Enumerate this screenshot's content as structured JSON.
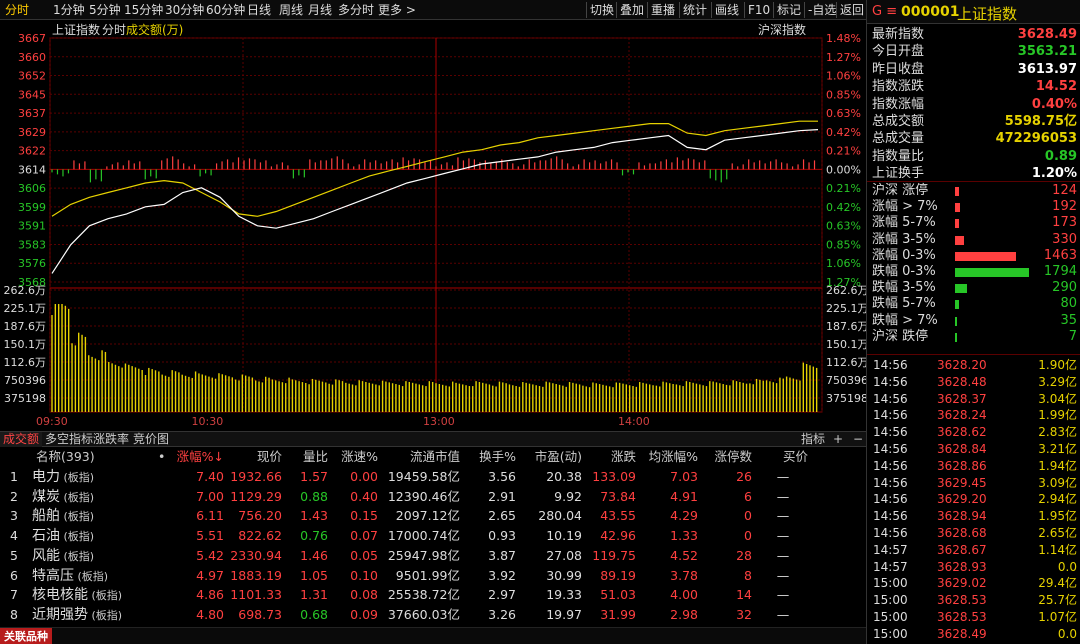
{
  "toolbar": {
    "periods": [
      "分时",
      "1分钟",
      "5分钟",
      "15分钟",
      "30分钟",
      "60分钟",
      "日线",
      "周线",
      "月线",
      "多分时",
      "更多 >"
    ],
    "tools": [
      "切换",
      "叠加",
      "重播",
      "统计",
      "画线",
      "F10",
      "标记",
      "-自选",
      "返回"
    ]
  },
  "chart": {
    "legend_name": "上证指数",
    "legend_mode": "分时",
    "legend_ind": "成交额(万)",
    "right_label": "沪深指数",
    "price_ticks": [
      "3667",
      "3660",
      "3652",
      "3645",
      "3637",
      "3629",
      "3622",
      "3614",
      "3606",
      "3599",
      "3591",
      "3583",
      "3576",
      "3568"
    ],
    "pct_ticks": [
      "1.48%",
      "1.27%",
      "1.06%",
      "0.85%",
      "0.63%",
      "0.42%",
      "0.21%",
      "0.00%",
      "0.21%",
      "0.42%",
      "0.63%",
      "0.85%",
      "1.06%",
      "1.27%"
    ],
    "vol_ticks": [
      "262.6万",
      "225.1万",
      "187.6万",
      "150.1万",
      "112.6万",
      "750396",
      "375198"
    ],
    "time_labels": [
      "09:30",
      "10:30",
      "13:00",
      "14:00"
    ]
  },
  "chart_data": {
    "type": "line",
    "title": "上证指数 分时",
    "prev_close": 3613.97,
    "x_labels": [
      "09:30",
      "10:30",
      "13:00",
      "14:00",
      "15:00"
    ],
    "series": [
      {
        "name": "指数",
        "color": "#ffffff",
        "values": [
          3568,
          3580,
          3588,
          3591,
          3593,
          3596,
          3597,
          3602,
          3604,
          3600,
          3592,
          3588,
          3587,
          3589,
          3591,
          3594,
          3597,
          3600,
          3603,
          3606,
          3608,
          3610,
          3612,
          3614,
          3615,
          3616,
          3617,
          3619,
          3620,
          3621,
          3623,
          3624,
          3625,
          3626,
          3621,
          3620,
          3624,
          3625,
          3626,
          3627,
          3628,
          3628.49
        ]
      },
      {
        "name": "均线",
        "color": "#e6d200",
        "values": [
          3592,
          3597,
          3600,
          3602,
          3604,
          3606,
          3607,
          3606,
          3602,
          3598,
          3593,
          3592,
          3594,
          3597,
          3600,
          3603,
          3606,
          3609,
          3611,
          3613,
          3615,
          3617,
          3619,
          3620,
          3622,
          3623,
          3625,
          3626,
          3627,
          3628,
          3629,
          3630,
          3631,
          3631,
          3627,
          3626,
          3628,
          3629,
          3630,
          3631,
          3632,
          3632
        ]
      }
    ],
    "volume": [
      262,
      180,
      140,
      120,
      110,
      100,
      95,
      92,
      90,
      88,
      85,
      80,
      78,
      76,
      75,
      74,
      72,
      72,
      71,
      70,
      70,
      69,
      68,
      70,
      69,
      68,
      68,
      69,
      68,
      67,
      67,
      68,
      68,
      69,
      70,
      70,
      71,
      72,
      75,
      78,
      85,
      112
    ],
    "ad_bars": [
      -1,
      2,
      -3,
      1,
      2,
      -2,
      3,
      1,
      -1,
      2,
      3,
      2,
      1,
      -2,
      2,
      3,
      1,
      2,
      2,
      3,
      2,
      1,
      3,
      2,
      2,
      1,
      2,
      3,
      1,
      2,
      2,
      -1,
      1,
      2,
      3,
      2,
      -3,
      1,
      2,
      2,
      1,
      2
    ]
  },
  "bottom_tabs": [
    "成交额",
    "多空指标",
    "涨跌率",
    "竞价图"
  ],
  "bottom_right": [
    "指标",
    "+",
    "−"
  ],
  "table": {
    "headers": [
      "名称(393)",
      "•",
      "涨幅%↓",
      "现价",
      "量比",
      "涨速%",
      "流通市值",
      "换手%",
      "市盈(动)",
      "涨跌",
      "均涨幅%",
      "涨停数",
      "买价"
    ],
    "rows": [
      {
        "idx": "1",
        "name": "电力",
        "tag": "(板指)",
        "pct": "7.40",
        "price": "1932.66",
        "lb": "1.57",
        "spd": "0.00",
        "cap": "19459.58亿",
        "turn": "3.56",
        "pe": "20.38",
        "chg": "133.09",
        "avg": "7.03",
        "zt": "26",
        "bid": "—"
      },
      {
        "idx": "2",
        "name": "煤炭",
        "tag": "(板指)",
        "pct": "7.00",
        "price": "1129.29",
        "lb": "0.88",
        "spd": "0.40",
        "cap": "12390.46亿",
        "turn": "2.91",
        "pe": "9.92",
        "chg": "73.84",
        "avg": "4.91",
        "zt": "6",
        "bid": "—"
      },
      {
        "idx": "3",
        "name": "船舶",
        "tag": "(板指)",
        "pct": "6.11",
        "price": "756.20",
        "lb": "1.43",
        "spd": "0.15",
        "cap": "2097.12亿",
        "turn": "2.65",
        "pe": "280.04",
        "chg": "43.55",
        "avg": "4.29",
        "zt": "0",
        "bid": "—"
      },
      {
        "idx": "4",
        "name": "石油",
        "tag": "(板指)",
        "pct": "5.51",
        "price": "822.62",
        "lb": "0.76",
        "spd": "0.07",
        "cap": "17000.74亿",
        "turn": "0.93",
        "pe": "10.19",
        "chg": "42.96",
        "avg": "1.33",
        "zt": "0",
        "bid": "—"
      },
      {
        "idx": "5",
        "name": "风能",
        "tag": "(板指)",
        "pct": "5.42",
        "price": "2330.94",
        "lb": "1.46",
        "spd": "0.05",
        "cap": "25947.98亿",
        "turn": "3.87",
        "pe": "27.08",
        "chg": "119.75",
        "avg": "4.52",
        "zt": "28",
        "bid": "—"
      },
      {
        "idx": "6",
        "name": "特高压",
        "tag": "(板指)",
        "pct": "4.97",
        "price": "1883.19",
        "lb": "1.05",
        "spd": "0.10",
        "cap": "9501.99亿",
        "turn": "3.92",
        "pe": "30.99",
        "chg": "89.19",
        "avg": "3.78",
        "zt": "8",
        "bid": "—"
      },
      {
        "idx": "7",
        "name": "核电核能",
        "tag": "(板指)",
        "pct": "4.86",
        "price": "1101.33",
        "lb": "1.31",
        "spd": "0.08",
        "cap": "25538.72亿",
        "turn": "2.97",
        "pe": "19.33",
        "chg": "51.03",
        "avg": "4.00",
        "zt": "14",
        "bid": "—"
      },
      {
        "idx": "8",
        "name": "近期强势",
        "tag": "(板指)",
        "pct": "4.80",
        "price": "698.73",
        "lb": "0.68",
        "spd": "0.09",
        "cap": "37660.03亿",
        "turn": "3.26",
        "pe": "19.97",
        "chg": "31.99",
        "avg": "2.98",
        "zt": "32",
        "bid": "—"
      }
    ]
  },
  "related_label": "关联品种",
  "panel": {
    "code_prefix": "G ≡",
    "code": "000001",
    "name": "上证指数",
    "stats": [
      {
        "label": "最新指数",
        "value": "3628.49",
        "color": "#ff4040"
      },
      {
        "label": "今日开盘",
        "value": "3563.21",
        "color": "#27c627"
      },
      {
        "label": "昨日收盘",
        "value": "3613.97",
        "color": "#ffffff"
      },
      {
        "label": "指数涨跌",
        "value": "14.52",
        "color": "#ff4040"
      },
      {
        "label": "指数涨幅",
        "value": "0.40%",
        "color": "#ff4040"
      },
      {
        "label": "总成交额",
        "value": "5598.75亿",
        "color": "#e6d200"
      },
      {
        "label": "总成交量",
        "value": "472296053",
        "color": "#e6d200"
      },
      {
        "label": "指数量比",
        "value": "0.89",
        "color": "#27c627"
      },
      {
        "label": "上证换手",
        "value": "1.20%",
        "color": "#ffffff"
      }
    ],
    "dist": [
      {
        "label": "沪深 涨停",
        "value": "124",
        "frac": 0.05,
        "color": "#ff4040"
      },
      {
        "label": "涨幅 > 7%",
        "value": "192",
        "frac": 0.07,
        "color": "#ff4040"
      },
      {
        "label": "涨幅 5-7%",
        "value": "173",
        "frac": 0.06,
        "color": "#ff4040"
      },
      {
        "label": "涨幅 3-5%",
        "value": "330",
        "frac": 0.12,
        "color": "#ff4040"
      },
      {
        "label": "涨幅 0-3%",
        "value": "1463",
        "frac": 0.82,
        "color": "#ff4040"
      },
      {
        "label": "跌幅 0-3%",
        "value": "1794",
        "frac": 1.0,
        "color": "#27c627"
      },
      {
        "label": "跌幅 3-5%",
        "value": "290",
        "frac": 0.16,
        "color": "#27c627"
      },
      {
        "label": "跌幅 5-7%",
        "value": "80",
        "frac": 0.05,
        "color": "#27c627"
      },
      {
        "label": "跌幅 > 7%",
        "value": "35",
        "frac": 0.02,
        "color": "#27c627"
      },
      {
        "label": "沪深 跌停",
        "value": "7",
        "frac": 0.01,
        "color": "#27c627"
      }
    ],
    "ticks": [
      {
        "t": "14:56",
        "p": "3628.20",
        "v": "1.90亿"
      },
      {
        "t": "14:56",
        "p": "3628.48",
        "v": "3.29亿"
      },
      {
        "t": "14:56",
        "p": "3628.37",
        "v": "3.04亿"
      },
      {
        "t": "14:56",
        "p": "3628.24",
        "v": "1.99亿"
      },
      {
        "t": "14:56",
        "p": "3628.62",
        "p_": "",
        "v": "2.83亿"
      },
      {
        "t": "14:56",
        "p": "3628.84",
        "v": "3.21亿"
      },
      {
        "t": "14:56",
        "p": "3628.86",
        "v": "1.94亿"
      },
      {
        "t": "14:56",
        "p": "3629.45",
        "v": "3.09亿"
      },
      {
        "t": "14:56",
        "p": "3629.20",
        "v": "2.94亿"
      },
      {
        "t": "14:56",
        "p": "3628.94",
        "v": "1.95亿"
      },
      {
        "t": "14:56",
        "p": "3628.68",
        "v": "2.65亿"
      },
      {
        "t": "14:57",
        "p": "3628.67",
        "v": "1.14亿"
      },
      {
        "t": "14:57",
        "p": "3628.93",
        "v": "0.0"
      },
      {
        "t": "15:00",
        "p": "3629.02",
        "v": "29.4亿"
      },
      {
        "t": "15:00",
        "p": "3628.53",
        "v": "25.7亿"
      },
      {
        "t": "15:00",
        "p": "3628.53",
        "v": "1.07亿"
      },
      {
        "t": "15:00",
        "p": "3628.49",
        "v": "0.0"
      }
    ]
  }
}
